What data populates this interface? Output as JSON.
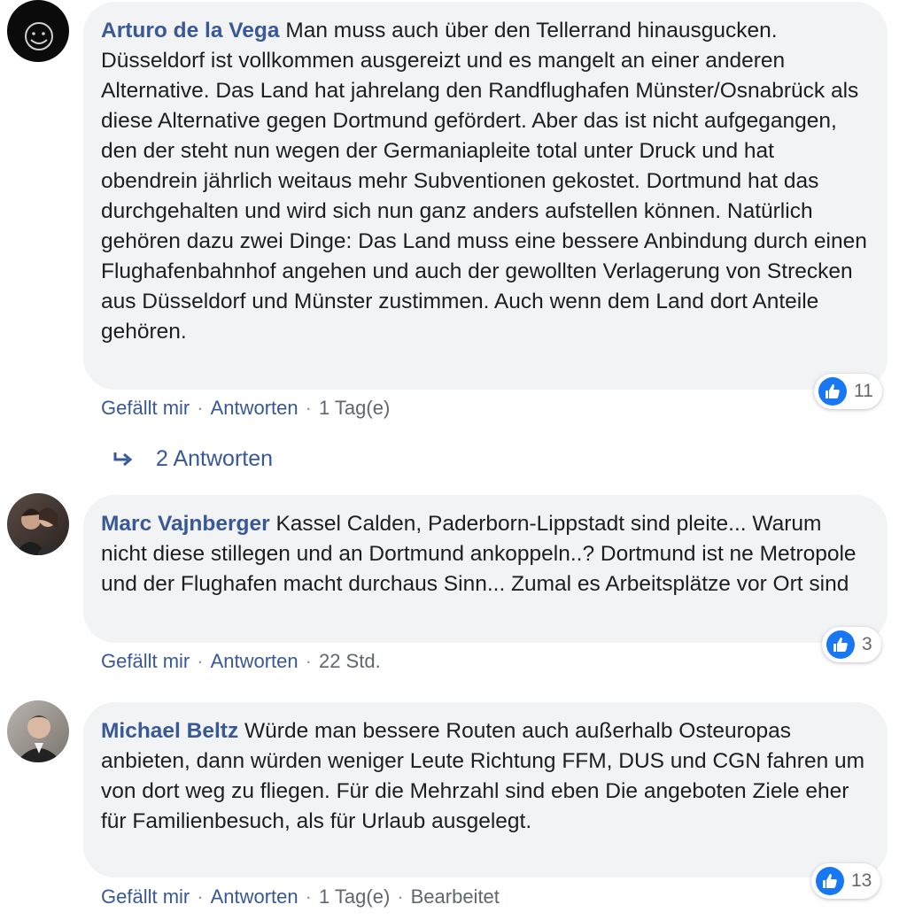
{
  "comments": [
    {
      "author": "Arturo de la Vega",
      "text": "Man muss auch über den Tellerrand hinausgucken. Düsseldorf ist vollkommen ausgereizt und es mangelt an einer anderen Alternative. Das Land hat jahrelang den Randflughafen Münster/Osnabrück als diese Alternative gegen Dortmund gefördert. Aber das ist nicht aufgegangen, den der steht nun wegen der Germaniapleite total unter Druck und hat obendrein jährlich weitaus mehr Subventionen gekostet. Dortmund hat das durchgehalten und wird sich nun ganz anders aufstellen können. Natürlich gehören dazu zwei Dinge: Das Land muss eine bessere Anbindung durch einen Flughafenbahnhof angehen und auch der gewollten Verlagerung von Strecken aus Düsseldorf und Münster zustimmen. Auch wenn dem Land dort Anteile gehören.",
      "like_label": "Gefällt mir",
      "reply_label": "Antworten",
      "time": "1 Tag(e)",
      "reaction_count": "11",
      "avatar_icon": "smiley-logo-avatar"
    },
    {
      "author": "Marc Vajnberger",
      "text": "Kassel Calden, Paderborn-Lippstadt sind pleite... Warum nicht diese stillegen und an Dortmund ankoppeln..? Dortmund ist ne Metropole und der Flughafen macht durchaus Sinn... Zumal es Arbeitsplätze vor Ort sind",
      "like_label": "Gefällt mir",
      "reply_label": "Antworten",
      "time": "22 Std.",
      "reaction_count": "3",
      "avatar_icon": "couple-photo-avatar"
    },
    {
      "author": "Michael Beltz",
      "text": "Würde man bessere Routen auch außerhalb Osteuropas anbieten, dann würden weniger Leute Richtung FFM, DUS und CGN fahren um von dort weg zu fliegen. Für die Mehrzahl sind eben Die angeboten Ziele eher für Familienbesuch, als für Urlaub ausgelegt.",
      "like_label": "Gefällt mir",
      "reply_label": "Antworten",
      "time": "1 Tag(e)",
      "edited": "Bearbeitet",
      "reaction_count": "13",
      "avatar_icon": "man-photo-avatar"
    }
  ],
  "replies_label": "2 Antworten",
  "colors": {
    "link": "#385898",
    "bubble": "#f2f3f5",
    "like": "#1877f2",
    "meta": "#606770"
  }
}
